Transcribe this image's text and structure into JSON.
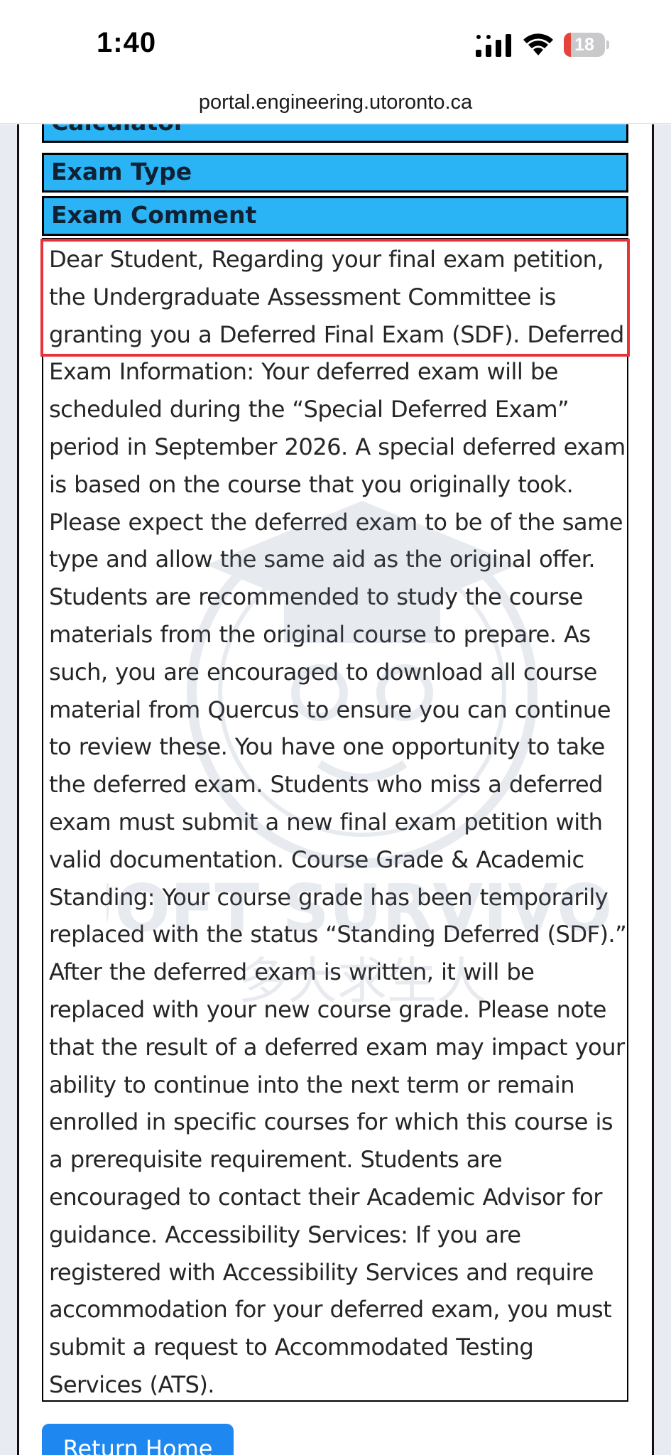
{
  "status_bar": {
    "time": "1:40",
    "battery_level": "18",
    "battery_fraction": 0.18,
    "icons": [
      "signal-icon",
      "wifi-icon",
      "battery-icon"
    ]
  },
  "browser": {
    "url": "portal.engineering.utoronto.ca"
  },
  "fields": {
    "calculator_label": "Calculator",
    "exam_type_label": "Exam Type",
    "exam_comment_label": "Exam Comment"
  },
  "comment": {
    "text": "Dear Student, Regarding your final exam petition, the Undergraduate Assessment Committee is granting you a Deferred Final Exam (SDF). Deferred Exam Information: Your deferred exam will be scheduled during the “Special Deferred Exam” period in September 2026. A special deferred exam is based on the course that you originally took. Please expect the deferred exam to be of the same type and allow the same aid as the original offer. Students are recommended to study the course materials from the original course to prepare. As such, you are encouraged to download all course material from Quercus to ensure you can continue to review these. You have one opportunity to take the deferred exam. Students who miss a deferred exam must submit a new final exam petition with valid documentation. Course Grade & Academic Standing: Your course grade has been temporarily replaced with the status “Standing Deferred (SDF).” After the deferred exam is written, it will be replaced with your new course grade. Please note that the result of a deferred exam may impact your ability to continue into the next term or remain enrolled in specific courses for which this course is a prerequisite requirement. Students are encouraged to contact their Academic Advisor for guidance. Accessibility Services: If you are registered with Accessibility Services and require accommodation for your deferred exam, you must submit a request to Accommodated Testing Services (ATS)."
  },
  "watermark": {
    "line1": "UOFT SURVIVOR",
    "line2": "多大求生人"
  },
  "actions": {
    "return_home_label": "Return Home"
  },
  "colors": {
    "header_blue": "#2ab4f6",
    "highlight_red": "#e8323a",
    "button_blue": "#1e88f0",
    "page_background": "#e9ebf2"
  }
}
